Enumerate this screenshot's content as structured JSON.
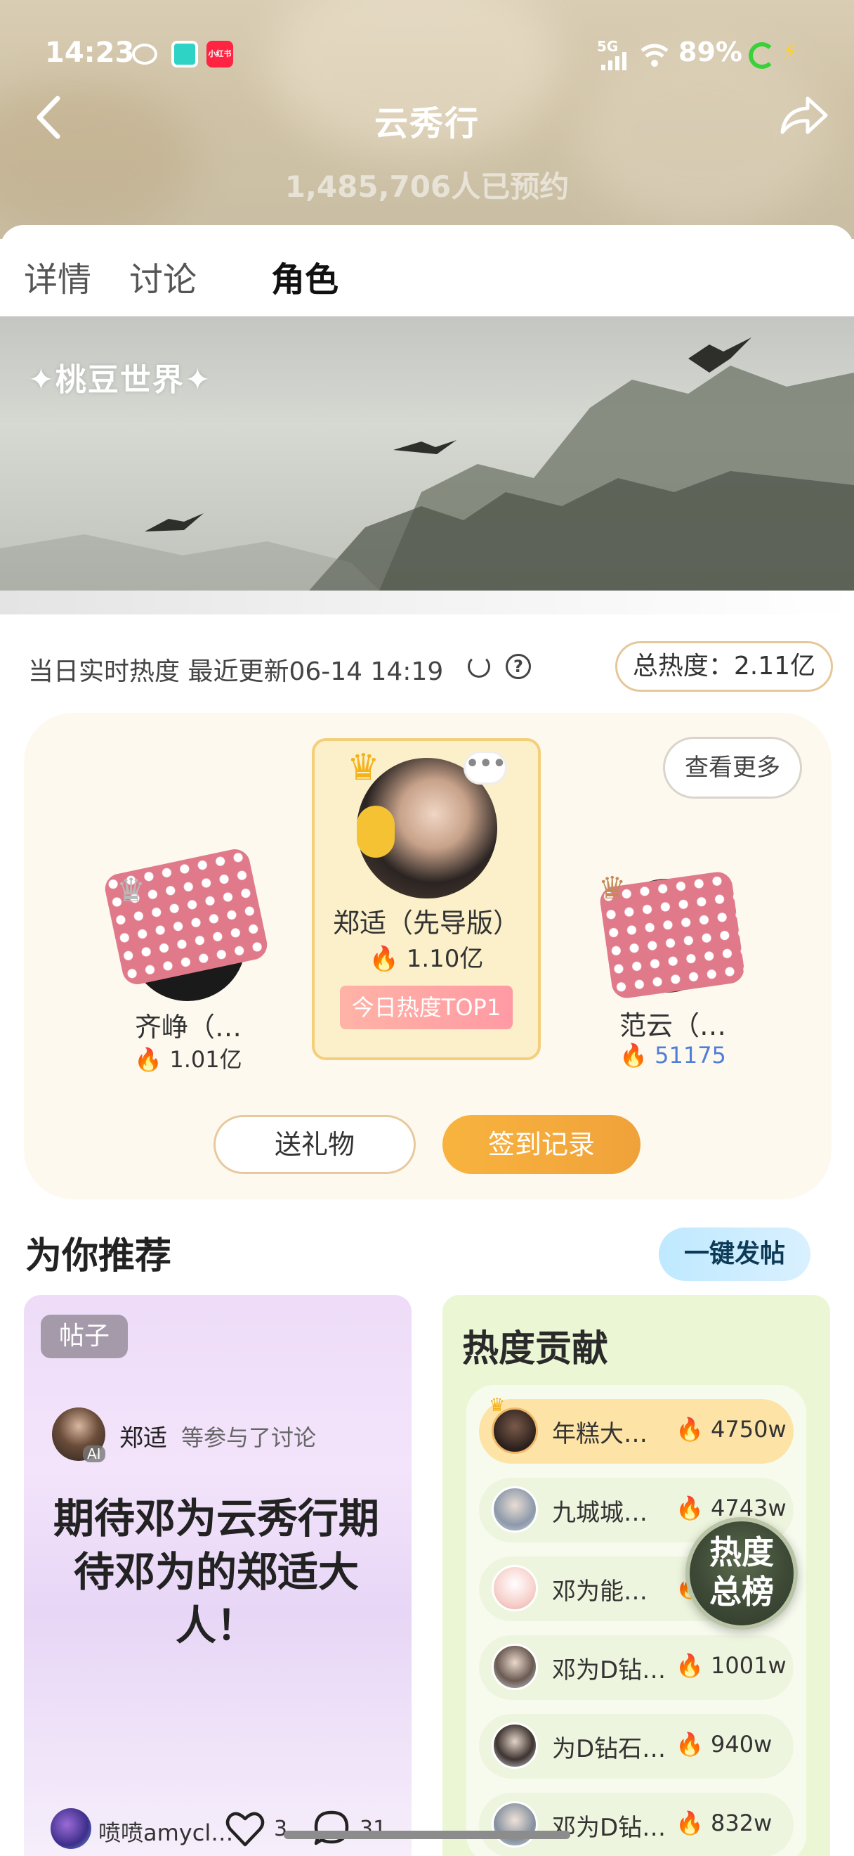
{
  "status_bar": {
    "time": "14:23",
    "network": "5G",
    "battery": "89%",
    "xhs_label": "小红书"
  },
  "header": {
    "title": "云秀行",
    "reservations": "1,485,706人已预约"
  },
  "tabs": [
    {
      "label": "详情",
      "active": false
    },
    {
      "label": "讨论",
      "active": false
    },
    {
      "label": "角色",
      "active": true
    }
  ],
  "banner": {
    "logo": "✦桃豆世界✦"
  },
  "heat": {
    "info": "当日实时热度 最近更新06-14 14:19",
    "help": "?",
    "total": "总热度：2.11亿"
  },
  "ranking": {
    "more_label": "查看更多",
    "first": {
      "name": "郑适（先导版）",
      "heat": "1.10亿",
      "badge": "今日热度TOP1",
      "crown": "♛",
      "dots": "•••"
    },
    "second": {
      "name": "齐峥（…",
      "heat": "1.01亿",
      "crown": "♛"
    },
    "third": {
      "name": "范云（…",
      "heat": "51175",
      "crown": "♛"
    },
    "gift_label": "送礼物",
    "checkin_label": "签到记录"
  },
  "recommend": {
    "title": "为你推荐",
    "post_button": "一键发帖",
    "post": {
      "tag": "帖子",
      "author": "郑适",
      "joined": "等参与了讨论",
      "ai": "AI",
      "content": "期待邓为云秀行期待邓为的郑适大人！",
      "footer_user": "喷喷amycl…",
      "likes": "3",
      "comments": "31"
    },
    "contrib": {
      "title": "热度贡献",
      "rows": [
        {
          "name": "年糕大…",
          "heat": "4750w"
        },
        {
          "name": "九城城…",
          "heat": "4743w"
        },
        {
          "name": "邓为能…",
          "heat": "…"
        },
        {
          "name": "邓为D钻…",
          "heat": "1001w"
        },
        {
          "name": "为D钻石…",
          "heat": "940w"
        },
        {
          "name": "邓为D钻…",
          "heat": "832w"
        }
      ]
    },
    "float_button": "热度总榜"
  },
  "colors": {
    "accent_orange": "#f0a23a",
    "gold_border": "#f4cf7a",
    "fire": "#ff6a1e"
  }
}
